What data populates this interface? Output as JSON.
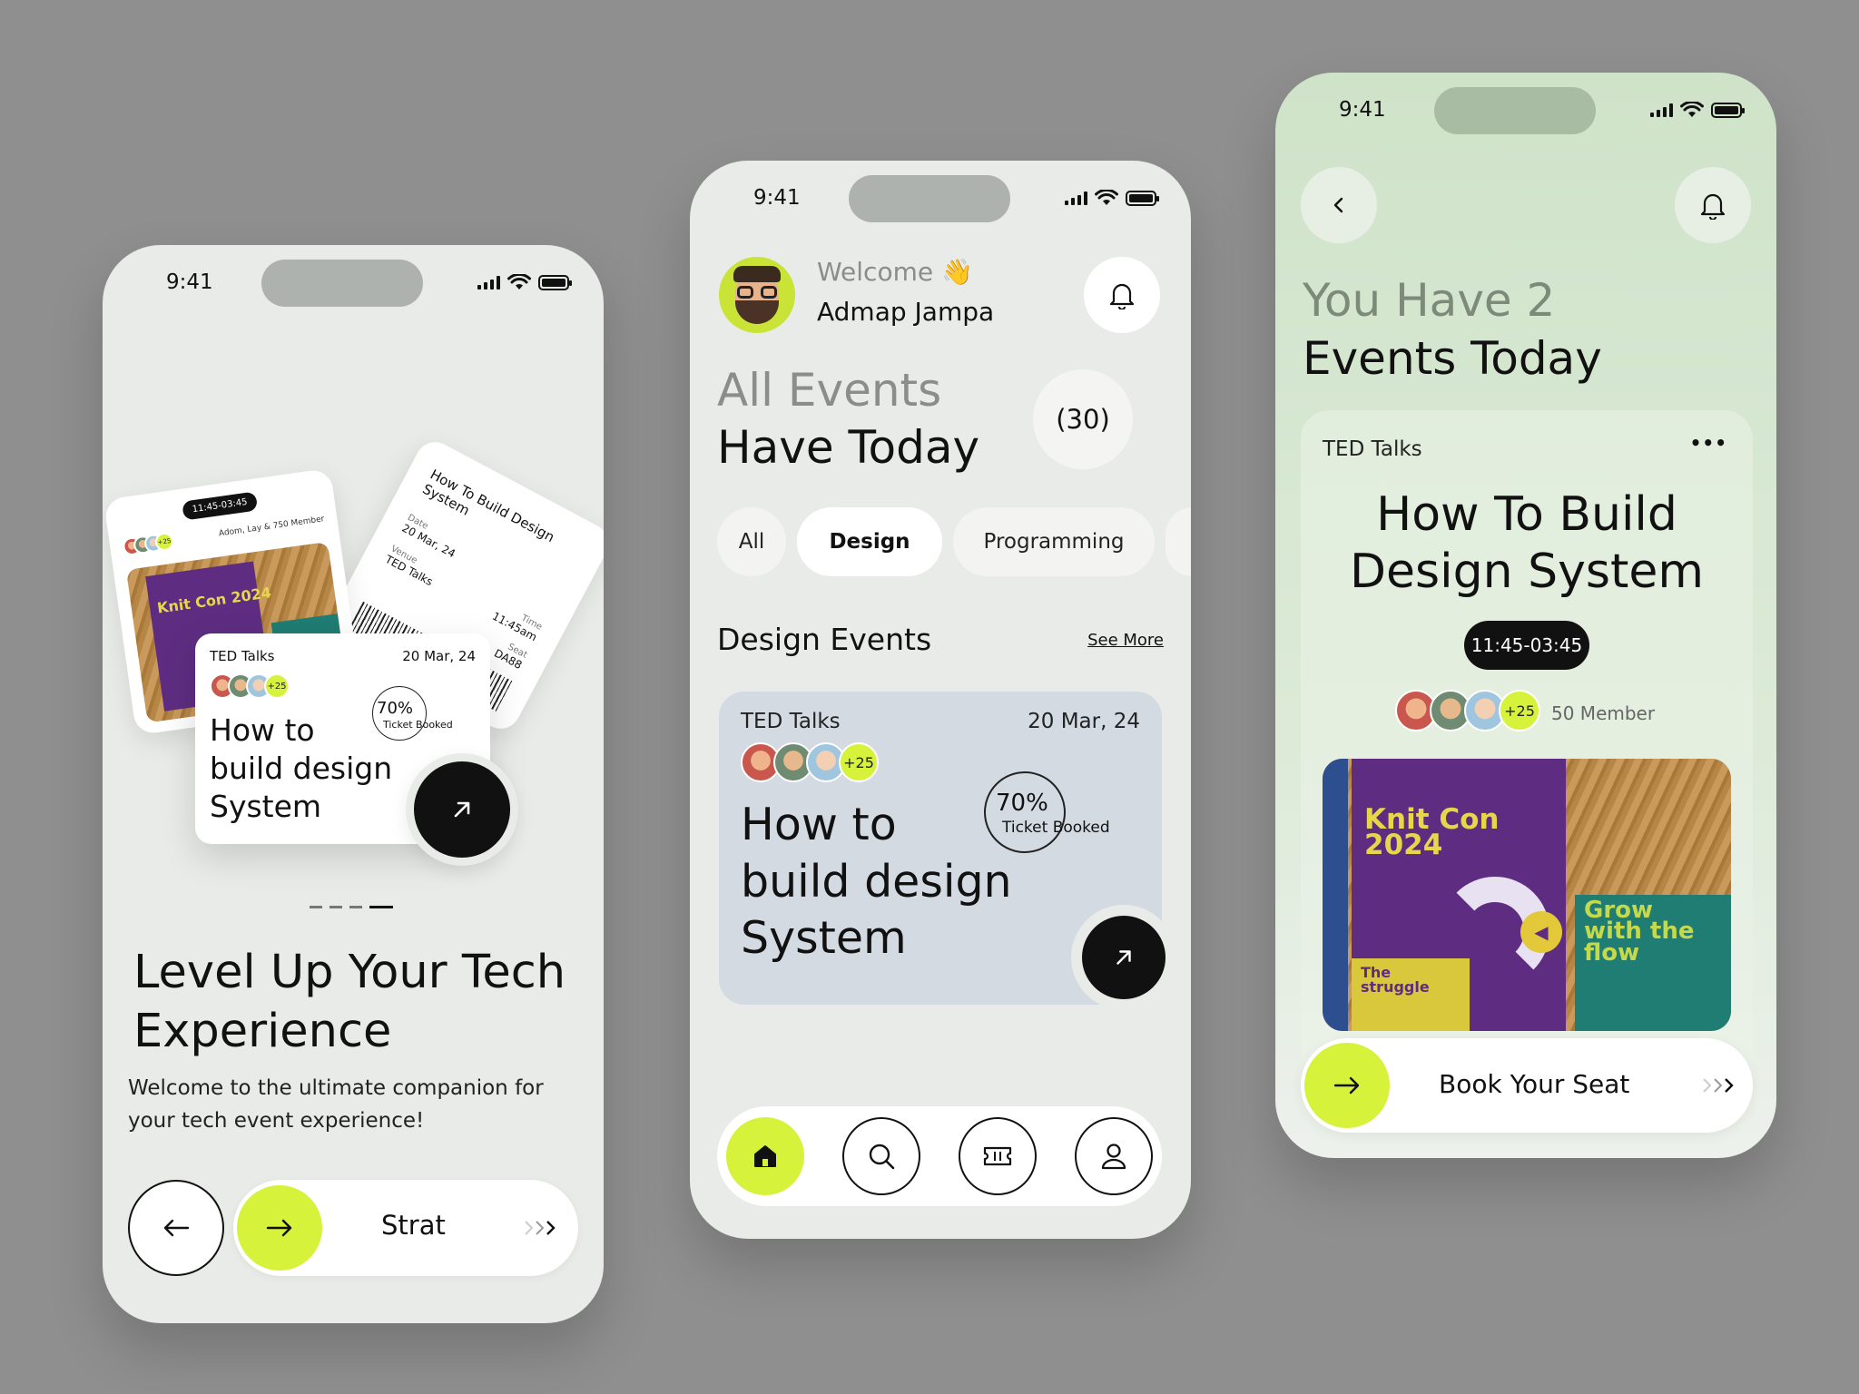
{
  "status": {
    "time": "9:41"
  },
  "phone1": {
    "ticket_front": {
      "org": "TED Talks",
      "date": "20 Mar, 24",
      "plus": "+25",
      "title_lines": [
        "How to",
        "build design",
        "System"
      ],
      "percent": "70%",
      "percent_label": "Ticket Booked"
    },
    "ticket_back": {
      "time_badge": "11:45-03:45",
      "members": "Adom, Lay & 750 Member",
      "plus": "+25",
      "poster_text": "Knit Con 2024"
    },
    "ticket_side": {
      "title": "How To Build Design System",
      "date_label": "Date",
      "date": "20 Mar, 24",
      "venue_label": "Venue",
      "venue": "TED Talks",
      "time_label": "Time",
      "time": "11:45am",
      "seat_label": "Seat",
      "seat": "DA88"
    },
    "headline_lines": [
      "Level Up Your Tech",
      "Experience"
    ],
    "subtitle_lines": [
      "Welcome to the ultimate companion for",
      "your tech event experience!"
    ],
    "start_label": "Strat",
    "pager": {
      "count": 4,
      "active": 3
    }
  },
  "phone2": {
    "welcome": "Welcome 👋",
    "user_name": "Admap Jampa",
    "heading_line1": "All Events",
    "heading_line2": "Have Today",
    "count_badge": "(30)",
    "tabs": [
      "All",
      "Design",
      "Programming"
    ],
    "active_tab": 1,
    "section_title": "Design Events",
    "see_more": "See More",
    "card": {
      "org": "TED Talks",
      "date": "20 Mar, 24",
      "plus": "+25",
      "title_lines": [
        "How to",
        "build design",
        "System"
      ],
      "percent": "70%",
      "percent_label": "Ticket Booked"
    },
    "nav": [
      "home-icon",
      "search-icon",
      "ticket-icon",
      "profile-icon"
    ]
  },
  "phone3": {
    "heading_line1": "You Have 2",
    "heading_line2": "Events Today",
    "card": {
      "org": "TED Talks",
      "more": "•••",
      "title_lines": [
        "How To Build",
        "Design System"
      ],
      "time_badge": "11:45-03:45",
      "plus": "+25",
      "members": "50 Member",
      "poster_title": "Knit Con 2024",
      "poster_grow": "Grow with the flow",
      "poster_struggle": "The struggle"
    },
    "cta_label": "Book Your Seat"
  },
  "colors": {
    "accent": "#d6f23a",
    "dark": "#111111",
    "bg": "#8f8f8f"
  }
}
